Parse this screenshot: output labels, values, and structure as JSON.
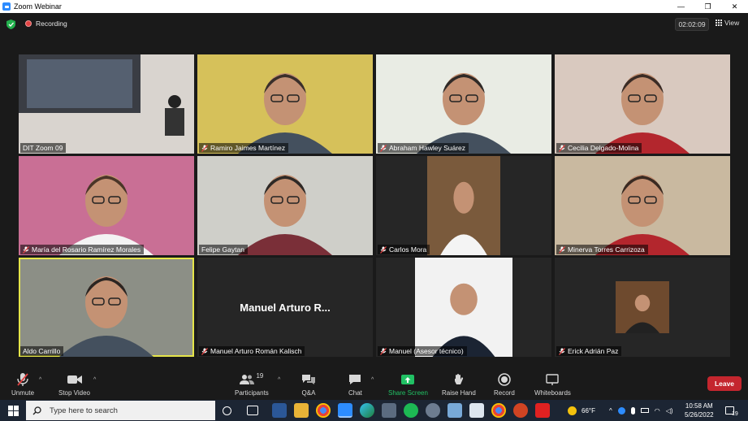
{
  "window": {
    "title": "Zoom Webinar",
    "minimize": "—",
    "restore": "❐",
    "close": "✕"
  },
  "meeting": {
    "recording_label": "Recording",
    "timer": "02:02:09",
    "view_label": "View"
  },
  "participants": [
    {
      "name": "DIT Zoom 09",
      "muted": false,
      "bg": "#d9d4cf"
    },
    {
      "name": "Ramiro Jaimes Martínez",
      "muted": true,
      "bg": "#d6c15a"
    },
    {
      "name": "Abraham Hawley Suárez",
      "muted": true,
      "bg": "#e9ece4"
    },
    {
      "name": "Cecilia Delgado-Molina",
      "muted": true,
      "bg": "#d9c9bf"
    },
    {
      "name": "María del Rosario Ramírez Morales",
      "muted": true,
      "bg": "#c96f95"
    },
    {
      "name": "Felipe Gaytan",
      "muted": false,
      "bg": "#cfcfc9"
    },
    {
      "name": "Carlos Mora",
      "muted": true,
      "bg": "#262626"
    },
    {
      "name": "Minerva Torres Carrizoza",
      "muted": true,
      "bg": "#c9b9a0"
    },
    {
      "name": "Aldo Carrillo",
      "muted": false,
      "bg": "#8c8f86"
    },
    {
      "name": "Manuel Arturo Román Kalisch",
      "muted": true,
      "bg": "#262626",
      "display_name": "Manuel Arturo R..."
    },
    {
      "name": "Manuel (Asesor técnico)",
      "muted": true,
      "bg": "#262626"
    },
    {
      "name": "Erick Adrián Paz",
      "muted": true,
      "bg": "#262626"
    }
  ],
  "toolbar": {
    "unmute": "Unmute",
    "stop_video": "Stop Video",
    "participants": "Participants",
    "participants_count": "19",
    "qa": "Q&A",
    "chat": "Chat",
    "share_screen": "Share Screen",
    "raise_hand": "Raise Hand",
    "record": "Record",
    "whiteboards": "Whiteboards",
    "leave": "Leave"
  },
  "taskbar": {
    "search_placeholder": "Type here to search",
    "weather": "66°F",
    "time": "10:58 AM",
    "date": "5/26/2022",
    "notifications": "19"
  },
  "colors": {
    "accent_green": "#21c164",
    "leave_red": "#c4262e",
    "active_speaker": "#e5e54a"
  }
}
